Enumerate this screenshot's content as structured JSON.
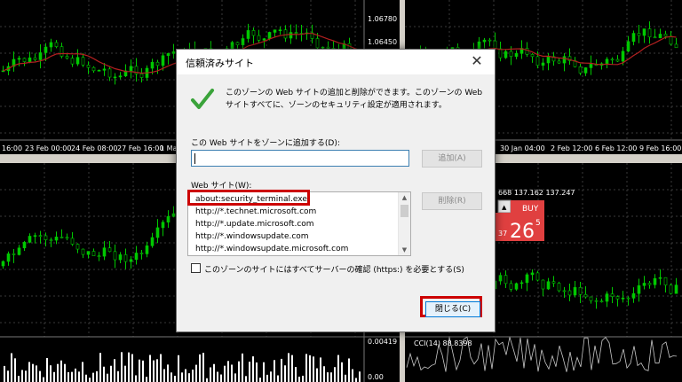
{
  "charts": {
    "top_left_axis": [
      "16:00",
      "23 Feb 00:00",
      "24 Feb 08:00",
      "27 Feb 16:00",
      "1 Ma"
    ],
    "top_left_prices": [
      "1.06780",
      "1.06450"
    ],
    "top_right_axis": [
      "30 Jan 04:00",
      "2 Feb 12:00",
      "6 Feb 12:00",
      "9 Feb 16:00"
    ],
    "trade_panel": {
      "quote_line": "668 137.162 137.247",
      "buy_label": "BUY",
      "price_small": "37",
      "price_big": "26",
      "price_sup": "5"
    },
    "bottom_left_prices": [
      "0.00419",
      "0.00"
    ],
    "bottom_right_indicator": "CCI(14) 88.8398"
  },
  "dialog": {
    "title": "信頼済みサイト",
    "description": "このゾーンの Web サイトの追加と削除ができます。このゾーンの Web サイトすべてに、ゾーンのセキュリティ設定が適用されます。",
    "add_label": "この Web サイトをゾーンに追加する(D):",
    "add_input_value": "",
    "add_button": "追加(A)",
    "websites_label": "Web サイト(W):",
    "remove_button": "削除(R)",
    "websites": [
      "about:security_terminal.exe",
      "http://*.technet.microsoft.com",
      "http://*.update.microsoft.com",
      "http://*.windowsupdate.com",
      "http://*.windowsupdate.microsoft.com"
    ],
    "https_checkbox_label": "このゾーンのサイトにはすべてサーバーの確認 (https:) を必要とする(S)",
    "https_checked": false,
    "close_button": "閉じる(C)",
    "highlight_color": "#cc0000"
  }
}
